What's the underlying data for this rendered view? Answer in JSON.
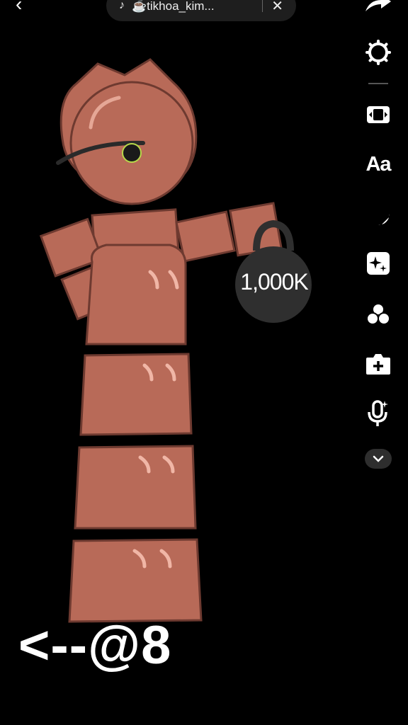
{
  "music": {
    "track_label": "☕tikhoa_kim..."
  },
  "toolbar": {
    "icons": [
      "back-arrow-icon",
      "music-note-icon",
      "close-icon",
      "share-icon",
      "settings-icon",
      "flip-icon",
      "text-tool-icon",
      "sticker-icon",
      "effects-icon",
      "filters-icon",
      "add-clip-icon",
      "voice-effect-icon",
      "chevron-down-icon"
    ],
    "text_tool_label": "Aa"
  },
  "scene": {
    "weight_label": "1,000K",
    "colors": {
      "block": "#b86a58",
      "block_edge": "#6e3a30",
      "weight": "#2f2f2f"
    }
  },
  "caption": {
    "text": "<--@8"
  }
}
